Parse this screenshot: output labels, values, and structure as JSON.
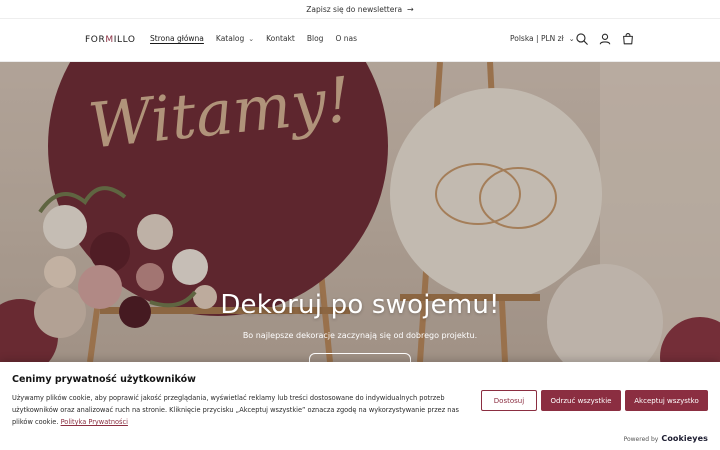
{
  "announcement": {
    "text": "Zapisz się do newslettera",
    "arrow": "→"
  },
  "header": {
    "logo_pre": "FOR",
    "logo_m": "M",
    "logo_post": "ILLO",
    "nav": [
      {
        "label": "Strona główna",
        "active": true
      },
      {
        "label": "Katalog",
        "has_dropdown": true
      },
      {
        "label": "Kontakt"
      },
      {
        "label": "Blog"
      },
      {
        "label": "O nas"
      }
    ],
    "locale": "Polska | PLN zł",
    "icons": [
      "search-icon",
      "account-icon",
      "cart-icon"
    ]
  },
  "hero": {
    "sign_text": "Witamy!",
    "title": "Dekoruj po swojemu!",
    "subtitle": "Bo najlepsze dekoracje zaczynają się od dobrego projektu."
  },
  "cookie": {
    "title": "Cenimy prywatność użytkowników",
    "text": "Używamy plików cookie, aby poprawić jakość przeglądania, wyświetlać reklamy lub treści dostosowane do indywidualnych potrzeb użytkowników oraz analizować ruch na stronie. Kliknięcie przycisku „Akceptuj wszystkie” oznacza zgodę na wykorzystywanie przez nas plików cookie.",
    "policy_link": "Polityka Prywatności",
    "btn_customize": "Dostosuj",
    "btn_reject": "Odrzuć wszystkie",
    "btn_accept": "Akceptuj wszystko",
    "powered_by": "Powered by",
    "powered_brand": "Cookieyes"
  },
  "colors": {
    "brand": "#8b2e41",
    "sign_burgundy": "#6e2a35",
    "sign_cream": "#eee7dc",
    "easel_wood": "#b98a5c"
  }
}
